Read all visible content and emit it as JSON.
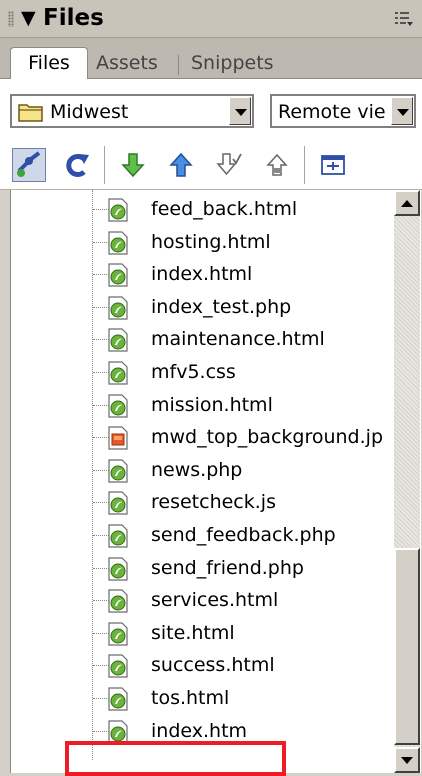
{
  "panel": {
    "title": "Files",
    "title_icon": "triangle-down",
    "options_icon": "panel-options-icon"
  },
  "tabs": [
    {
      "label": "Files",
      "active": true
    },
    {
      "label": "Assets",
      "active": false
    },
    {
      "label": "Snippets",
      "active": false
    }
  ],
  "toolbar": {
    "site_select": {
      "value": "Midwest",
      "icon": "folder-icon"
    },
    "view_select": {
      "value": "Remote vie"
    },
    "buttons": [
      "connect-icon",
      "refresh-icon",
      "get-icon",
      "put-icon",
      "check-out-icon",
      "check-in-icon",
      "expand-icon"
    ]
  },
  "files": [
    {
      "name": "feed_back.html",
      "icon": "html-file-icon"
    },
    {
      "name": "hosting.html",
      "icon": "html-file-icon"
    },
    {
      "name": "index.html",
      "icon": "html-file-icon"
    },
    {
      "name": "index_test.php",
      "icon": "html-file-icon"
    },
    {
      "name": "maintenance.html",
      "icon": "html-file-icon"
    },
    {
      "name": "mfv5.css",
      "icon": "html-file-icon"
    },
    {
      "name": "mission.html",
      "icon": "html-file-icon"
    },
    {
      "name": "mwd_top_background.jp",
      "icon": "image-file-icon"
    },
    {
      "name": "news.php",
      "icon": "html-file-icon"
    },
    {
      "name": "resetcheck.js",
      "icon": "html-file-icon"
    },
    {
      "name": "send_feedback.php",
      "icon": "html-file-icon"
    },
    {
      "name": "send_friend.php",
      "icon": "html-file-icon"
    },
    {
      "name": "services.html",
      "icon": "html-file-icon"
    },
    {
      "name": "site.html",
      "icon": "html-file-icon"
    },
    {
      "name": "success.html",
      "icon": "html-file-icon"
    },
    {
      "name": "tos.html",
      "icon": "html-file-icon"
    },
    {
      "name": "index.htm",
      "icon": "html-file-icon",
      "highlighted": true
    }
  ],
  "colors": {
    "highlight": "#ee1c24",
    "panel_bg": "#d4d0c8",
    "file_icon_green": "#6cb33e"
  }
}
